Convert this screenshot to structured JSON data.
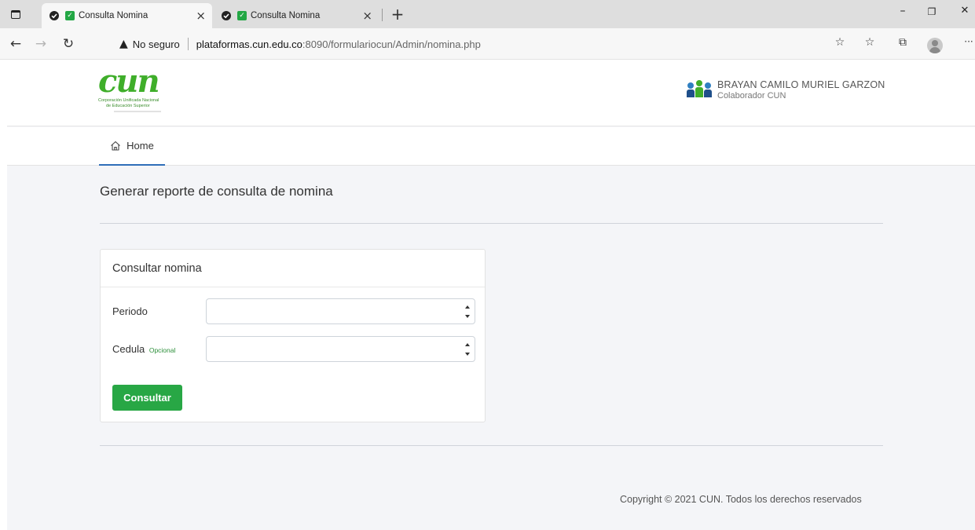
{
  "browser": {
    "tabs": [
      {
        "title": "Consulta Nomina",
        "close": "×"
      },
      {
        "title": "Consulta Nomina",
        "close": "×"
      }
    ],
    "new_tab": "+",
    "security_warning": "No seguro",
    "url_host": "plataformas.cun.edu.co",
    "url_rest": ":8090/formulariocun/Admin/nomina.php",
    "window_controls": {
      "minimize": "–",
      "restore": "❐",
      "close": "✕"
    },
    "nav": {
      "back": "←",
      "forward": "→",
      "reload": "↻"
    },
    "toolbar": {
      "favorites_add": "☆",
      "favorites": "☆",
      "collections": "⧉",
      "menu": "···"
    }
  },
  "header": {
    "logo_word": "cun",
    "logo_line1": "Corporación Unificada Nacional",
    "logo_line2": "de Educación Superior",
    "user_name": "BRAYAN CAMILO MURIEL GARZON",
    "user_role": "Colaborador CUN"
  },
  "nav": {
    "home_label": "Home"
  },
  "main": {
    "title": "Generar reporte de consulta de nomina",
    "card_title": "Consultar nomina",
    "fields": [
      {
        "label": "Periodo",
        "value": ""
      },
      {
        "label": "Cedula",
        "optional_tag": "Opcional",
        "value": ""
      }
    ],
    "submit_label": "Consultar"
  },
  "footer": {
    "copyright": "Copyright © 2021 CUN. Todos los derechos reservados"
  },
  "colors": {
    "brand_green": "#3fae2a",
    "button_green": "#28a745",
    "nav_active": "#2f6eb8"
  }
}
